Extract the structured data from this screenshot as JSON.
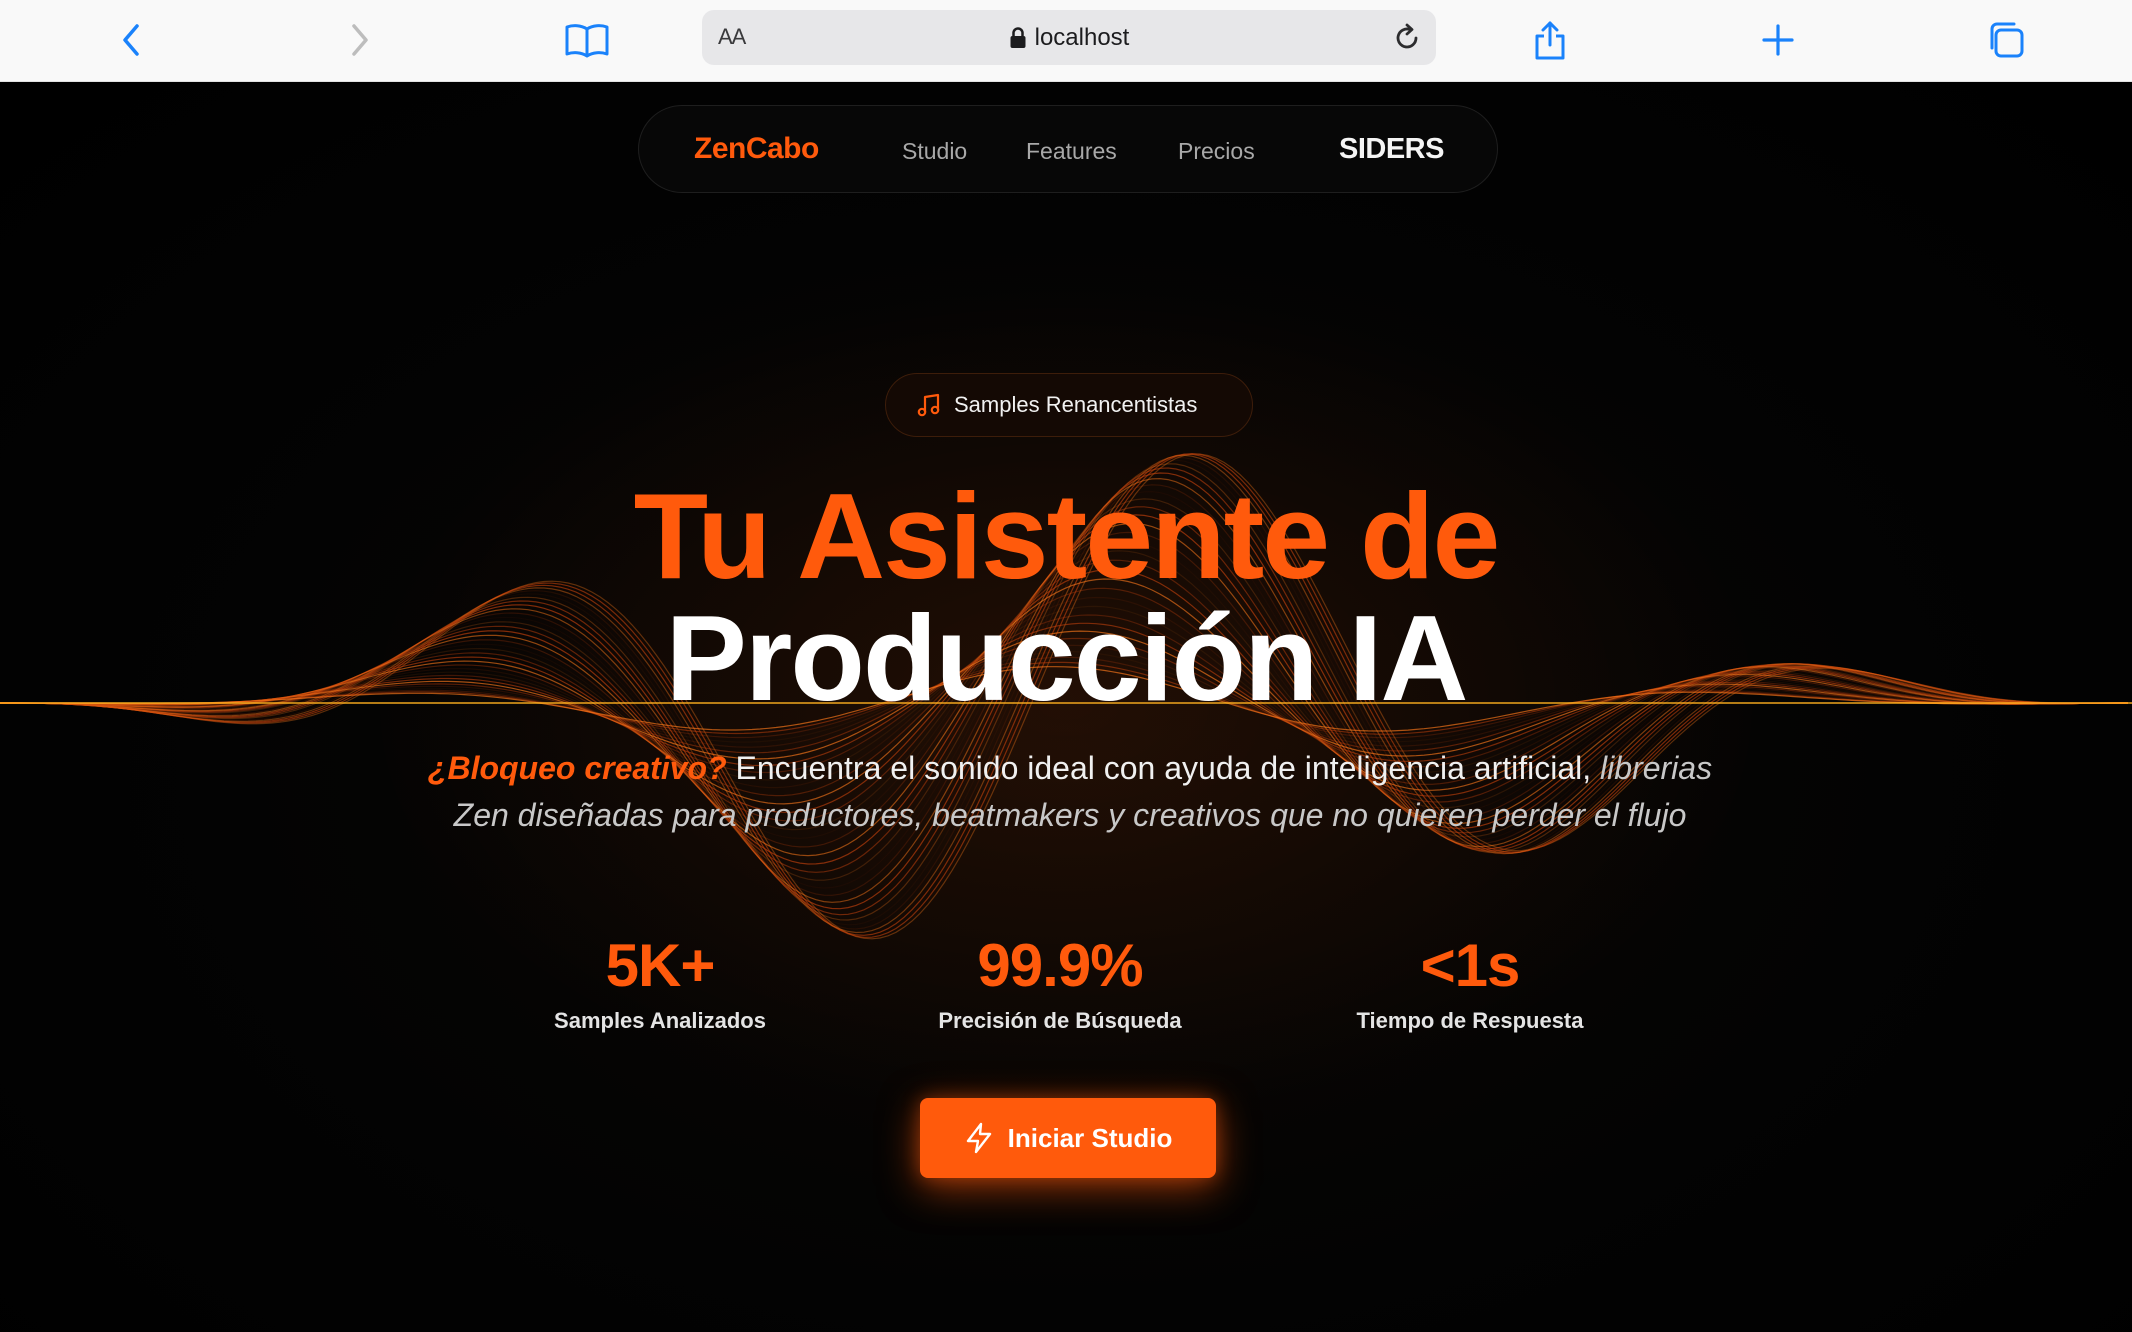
{
  "browser": {
    "text_size_label": "AA",
    "url": "localhost",
    "icons": [
      "chevron-left-icon",
      "chevron-right-icon",
      "book-icon",
      "lock-icon",
      "reload-icon",
      "share-icon",
      "plus-icon",
      "tabs-icon"
    ],
    "accent_color": "#1a82fb"
  },
  "nav": {
    "brand": "ZenCabo",
    "links": [
      "Studio",
      "Features",
      "Precios"
    ],
    "cta": "SIDERS"
  },
  "hero": {
    "badge": "Samples Renancentistas",
    "badge_icon": "music-note-icon",
    "title_line1": "Tu Asistente de",
    "title_line2": "Producción IA",
    "subtitle": {
      "highlight": "¿Bloqueo creativo?",
      "plain": "Encuentra el sonido ideal con ayuda de inteligencia artificial,",
      "italic": "librerias Zen diseñadas para productores, beatmakers y creativos que no quieren perder el flujo"
    },
    "stats": [
      {
        "value": "5K+",
        "label": "Samples Analizados"
      },
      {
        "value": "99.9%",
        "label": "Precisión de Búsqueda"
      },
      {
        "value": "<1s",
        "label": "Tiempo de Respuesta"
      }
    ],
    "cta_label": "Iniciar Studio",
    "cta_icon": "lightning-icon"
  },
  "colors": {
    "accent": "#ff5a0c",
    "background": "#000000"
  }
}
